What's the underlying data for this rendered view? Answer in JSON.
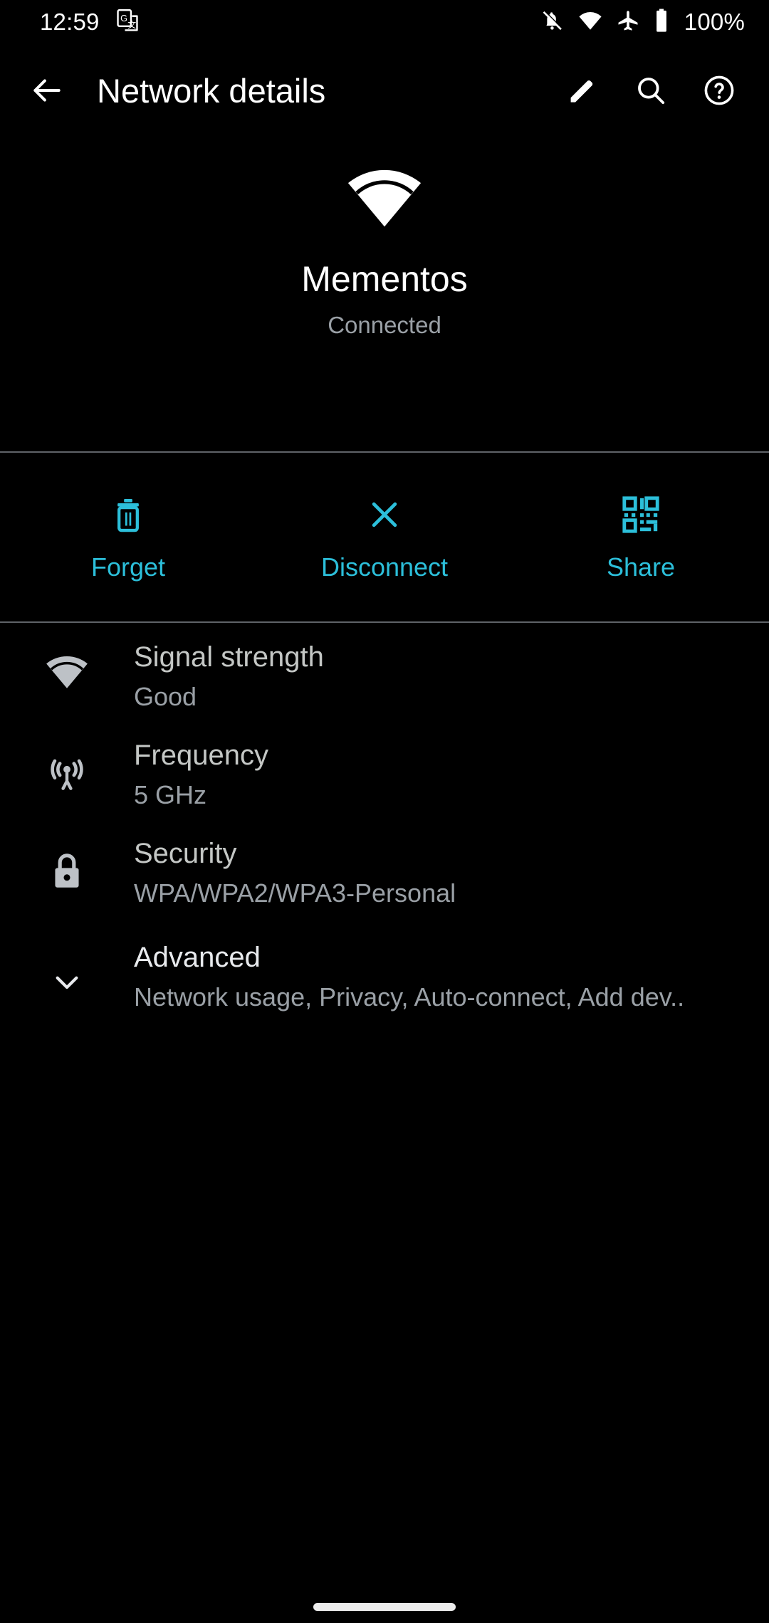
{
  "status_bar": {
    "time": "12:59",
    "battery_percent": "100%",
    "icons": [
      "google-translate-icon",
      "notifications-off-icon",
      "wifi-icon",
      "airplane-mode-icon",
      "battery-full-icon"
    ]
  },
  "app_bar": {
    "back_icon": "arrow-back-icon",
    "title": "Network details",
    "actions": [
      {
        "name": "edit-button",
        "icon": "pencil-icon"
      },
      {
        "name": "search-button",
        "icon": "search-icon"
      },
      {
        "name": "help-button",
        "icon": "help-circle-icon"
      }
    ]
  },
  "network_header": {
    "icon": "wifi-signal-icon",
    "ssid": "Mementos",
    "state": "Connected"
  },
  "actions": {
    "accent_color": "#2cbfda",
    "items": [
      {
        "label": "Forget",
        "icon": "trash-icon"
      },
      {
        "label": "Disconnect",
        "icon": "close-x-icon"
      },
      {
        "label": "Share",
        "icon": "qr-code-icon"
      }
    ]
  },
  "details": [
    {
      "icon": "wifi-signal-icon",
      "title": "Signal strength",
      "value": "Good"
    },
    {
      "icon": "broadcast-tower-icon",
      "title": "Frequency",
      "value": "5 GHz"
    },
    {
      "icon": "lock-icon",
      "title": "Security",
      "value": "WPA/WPA2/WPA3-Personal"
    }
  ],
  "advanced": {
    "icon": "chevron-down-icon",
    "title": "Advanced",
    "summary": "Network usage, Privacy, Auto-connect, Add dev.."
  },
  "navigation_bar": {
    "handle": "gesture-home-handle"
  }
}
